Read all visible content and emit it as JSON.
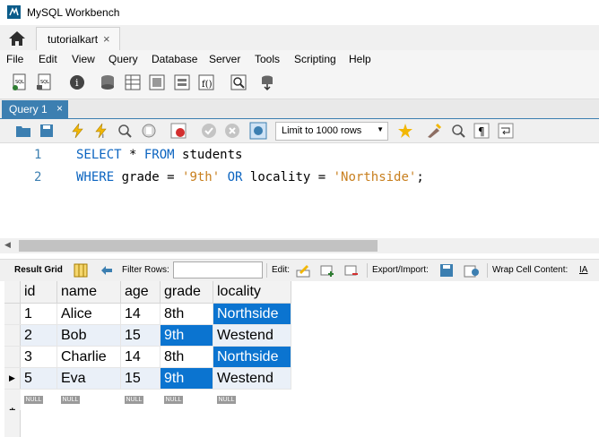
{
  "window": {
    "title": "MySQL Workbench"
  },
  "connection_tabs": [
    {
      "label": "tutorialkart",
      "close": "×"
    }
  ],
  "menu": [
    "File",
    "Edit",
    "View",
    "Query",
    "Database",
    "Server",
    "Tools",
    "Scripting",
    "Help"
  ],
  "query_tab": {
    "label": "Query 1",
    "close": "×"
  },
  "sql_toolbar": {
    "limit_value": "Limit to 1000 rows"
  },
  "editor": {
    "lines": [
      {
        "number": "1",
        "tokens": [
          {
            "t": "SELECT",
            "c": "kw"
          },
          {
            "t": " * ",
            "c": "op"
          },
          {
            "t": "FROM",
            "c": "kw"
          },
          {
            "t": " students",
            "c": "op"
          }
        ]
      },
      {
        "number": "2",
        "tokens": [
          {
            "t": "WHERE",
            "c": "kw"
          },
          {
            "t": " grade = ",
            "c": "op"
          },
          {
            "t": "'9th'",
            "c": "str"
          },
          {
            "t": " ",
            "c": "op"
          },
          {
            "t": "OR",
            "c": "kw"
          },
          {
            "t": " locality = ",
            "c": "op"
          },
          {
            "t": "'Northside'",
            "c": "str"
          },
          {
            "t": ";",
            "c": "op"
          }
        ]
      }
    ]
  },
  "result_toolbar": {
    "result_grid": "Result Grid",
    "filter_rows": "Filter Rows:",
    "edit": "Edit:",
    "export_import": "Export/Import:",
    "wrap": "Wrap Cell Content:",
    "wrap_icon": "IA"
  },
  "grid": {
    "columns": [
      "id",
      "name",
      "age",
      "grade",
      "locality"
    ],
    "rows": [
      {
        "cells": [
          "1",
          "Alice",
          "14",
          "8th",
          "Northside"
        ],
        "selected": [
          false,
          false,
          false,
          false,
          true
        ],
        "marker": ""
      },
      {
        "cells": [
          "2",
          "Bob",
          "15",
          "9th",
          "Westend"
        ],
        "selected": [
          false,
          false,
          false,
          true,
          false
        ],
        "marker": ""
      },
      {
        "cells": [
          "3",
          "Charlie",
          "14",
          "8th",
          "Northside"
        ],
        "selected": [
          false,
          false,
          false,
          false,
          true
        ],
        "marker": ""
      },
      {
        "cells": [
          "5",
          "Eva",
          "15",
          "9th",
          "Westend"
        ],
        "selected": [
          false,
          false,
          false,
          true,
          false
        ],
        "marker": "▶"
      }
    ],
    "null_label": "NULL",
    "new_row_marker": "✱"
  },
  "colors": {
    "accent": "#3c7fb1",
    "selection": "#0b74d0",
    "keyword": "#0b64c0",
    "string": "#c87f1e"
  }
}
